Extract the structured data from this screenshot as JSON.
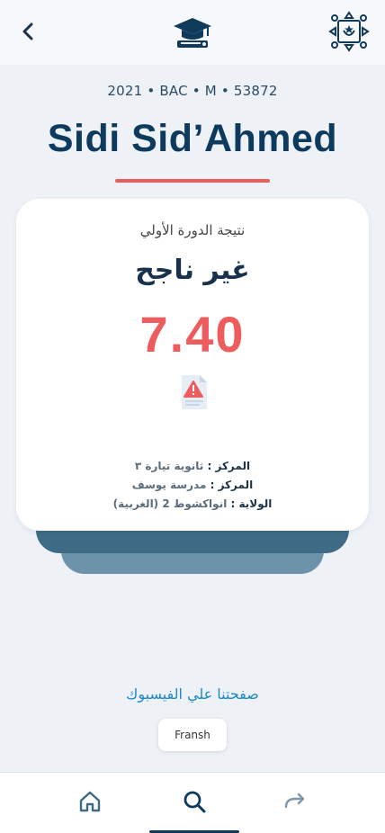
{
  "header": {
    "back_icon": "chevron-left-icon",
    "logo_icon": "graduation-cap-icon",
    "emblem_icon": "emblem-icon"
  },
  "student": {
    "meta": "2021 • BAC • M • 53872",
    "name": "Sidi Sid’Ahmed"
  },
  "result_card": {
    "session_label": "نتيجة الدورة الأولي",
    "status": "غير ناجح",
    "score": "7.40",
    "status_icon": "warning-document-icon",
    "details": [
      {
        "label": "المركز :",
        "value": "ثانوية  تيارة ٣"
      },
      {
        "label": "المركز :",
        "value": "مدرسة يوسف"
      },
      {
        "label": "الولاية :",
        "value": "انواكشوط 2 (الغربية)"
      }
    ]
  },
  "footer": {
    "facebook_link": "صفحتنا علي الفيسبوك",
    "language_button": "Fransh"
  },
  "bottom_nav": {
    "items": [
      {
        "name": "home",
        "icon": "home-icon",
        "active": false
      },
      {
        "name": "search",
        "icon": "search-icon",
        "active": true
      },
      {
        "name": "share",
        "icon": "share-arrow-icon",
        "active": false
      }
    ]
  },
  "colors": {
    "primary": "#0e3a5e",
    "accent_red": "#ee5d5d",
    "link_blue": "#1e88c8",
    "background": "#eef2f7"
  }
}
